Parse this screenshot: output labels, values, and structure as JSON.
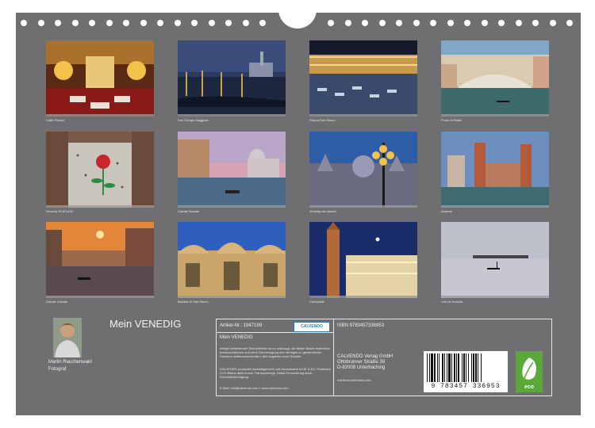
{
  "calendar": {
    "title": "Mein VENEDIG",
    "author": {
      "name": "Martin Rauchenwald",
      "role": "Fotograf"
    }
  },
  "photos": [
    {
      "caption": "Caffe Florian"
    },
    {
      "caption": "San Giorgio Maggiore"
    },
    {
      "caption": "Piazza San Marco"
    },
    {
      "caption": "Ponte di Rialto"
    },
    {
      "caption": "Venezia RIVELATA"
    },
    {
      "caption": "Canale Grande"
    },
    {
      "caption": "Venedig am Abend"
    },
    {
      "caption": "Arsenal"
    },
    {
      "caption": "Canale Grande"
    },
    {
      "caption": "Basilica di San Marco"
    },
    {
      "caption": "Campanile"
    },
    {
      "caption": "Lido di Venezia"
    }
  ],
  "info": {
    "article": "Artikel-Nr.: 1947199",
    "publisher_logo": "CALVENDO",
    "isbn": "ISBN 9783457336953",
    "product_title": "Mein VENEDIG",
    "copyright_text": "Infolge bestehender Schutzrechte ist es untersagt, die Bilder dieses Kalenders herauszutrennen und ohne Genehmigung des Verlages zu gewerblichen Zwecken weiterzuverwenden. Alle Angaben ohne Gewähr.",
    "co2_text": "CALVENDO produziert bedarfsgerecht und klimaneutral in DE & EU. Positivere CO2-Bilanz dank kurzer Transportwege, Abfall-Reduzierung dank Einzelstückfertigung.",
    "contact": "E-Mail: info@calvendo.com • www.calvendo.com",
    "publisher_name": "CALVENDO Verlag GmbH",
    "publisher_street": "Ottobrunner Straße 39",
    "publisher_city": "D-82008 Unterhaching",
    "author_site": "martinrauchenwald.com",
    "barcode_number": "9 783457 336953",
    "eco_label": "eco"
  },
  "colors": {
    "background": "#6f6f71",
    "eco_green": "#5aa83a",
    "logo_blue": "#2a7ab8"
  }
}
